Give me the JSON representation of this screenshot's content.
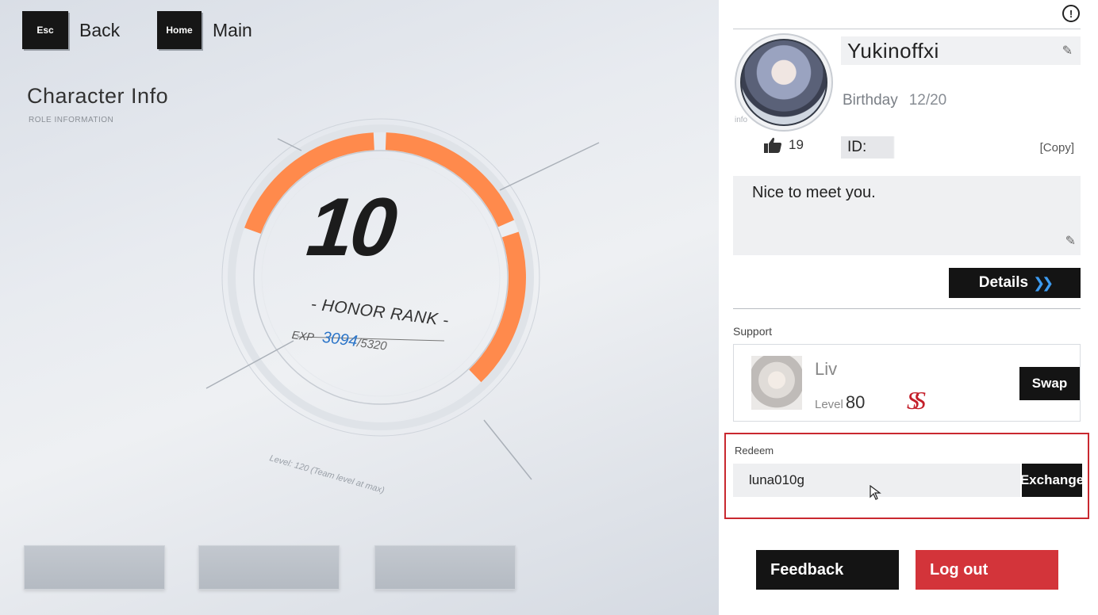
{
  "nav": {
    "back_key": "Esc",
    "back_label": "Back",
    "home_key": "Home",
    "home_label": "Main"
  },
  "page": {
    "title": "Character Info",
    "subtitle": "ROLE INFORMATION"
  },
  "honor": {
    "rank": "10",
    "label": "- HONOR RANK -",
    "exp_label": "EXP",
    "exp_current": "3094",
    "exp_max": "/5320",
    "progress": 0.58,
    "level_note": "Level: 120 (Team level at max)"
  },
  "profile": {
    "avatar_tag": "info",
    "name": "Yukinoffxi",
    "birthday_label": "Birthday",
    "birthday_value": "12/20",
    "likes": "19",
    "id_label": "ID:",
    "copy_label": "[Copy]",
    "bio": "Nice to meet you.",
    "details_label": "Details"
  },
  "support": {
    "section_label": "Support",
    "name": "Liv",
    "level_label": "Level",
    "level_value": "80",
    "rank": "SS",
    "swap_label": "Swap"
  },
  "redeem": {
    "section_label": "Redeem",
    "value": "luna010g",
    "exchange_label": "Exchange"
  },
  "footer": {
    "feedback_label": "Feedback",
    "logout_label": "Log out"
  },
  "colors": {
    "accent_orange": "#ff8a4c",
    "logout_red": "#d3343a",
    "exp_blue": "#2a74c8",
    "highlight_red": "#c9282f"
  },
  "icons": [
    "info-icon",
    "edit-icon",
    "thumbs-up-icon",
    "chevron-double-right-icon",
    "mouse-cursor-icon"
  ]
}
